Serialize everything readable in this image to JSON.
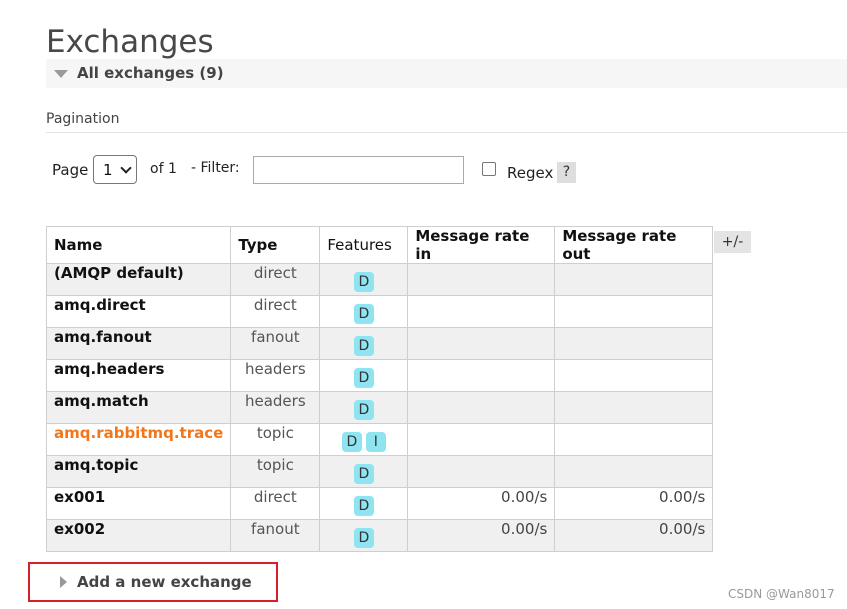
{
  "page": {
    "title": "Exchanges",
    "section_label": "All exchanges (9)"
  },
  "pagination": {
    "label": "Pagination",
    "page_word": "Page",
    "page_value": "1",
    "of_text": "of 1",
    "filter_label": "- Filter:",
    "filter_value": "",
    "regex_label": "Regex",
    "help_label": "?"
  },
  "table": {
    "headers": {
      "name": "Name",
      "type": "Type",
      "features": "Features",
      "rate_in": "Message rate in",
      "rate_out": "Message rate out"
    },
    "toggle_columns_label": "+/-",
    "rows": [
      {
        "name": "(AMQP default)",
        "type": "direct",
        "features": [
          "D"
        ],
        "rate_in": "",
        "rate_out": ""
      },
      {
        "name": "amq.direct",
        "type": "direct",
        "features": [
          "D"
        ],
        "rate_in": "",
        "rate_out": ""
      },
      {
        "name": "amq.fanout",
        "type": "fanout",
        "features": [
          "D"
        ],
        "rate_in": "",
        "rate_out": ""
      },
      {
        "name": "amq.headers",
        "type": "headers",
        "features": [
          "D"
        ],
        "rate_in": "",
        "rate_out": ""
      },
      {
        "name": "amq.match",
        "type": "headers",
        "features": [
          "D"
        ],
        "rate_in": "",
        "rate_out": ""
      },
      {
        "name": "amq.rabbitmq.trace",
        "type": "topic",
        "features": [
          "D",
          "I"
        ],
        "rate_in": "",
        "rate_out": "",
        "internal": true
      },
      {
        "name": "amq.topic",
        "type": "topic",
        "features": [
          "D"
        ],
        "rate_in": "",
        "rate_out": ""
      },
      {
        "name": "ex001",
        "type": "direct",
        "features": [
          "D"
        ],
        "rate_in": "0.00/s",
        "rate_out": "0.00/s"
      },
      {
        "name": "ex002",
        "type": "fanout",
        "features": [
          "D"
        ],
        "rate_in": "0.00/s",
        "rate_out": "0.00/s"
      }
    ]
  },
  "add_section": {
    "label": "Add a new exchange"
  },
  "watermark": "CSDN @Wan8017",
  "colors": {
    "internal_exchange": "#f3761a",
    "feature_badge": "#8fe4f0",
    "highlight_box": "#d4202a"
  }
}
